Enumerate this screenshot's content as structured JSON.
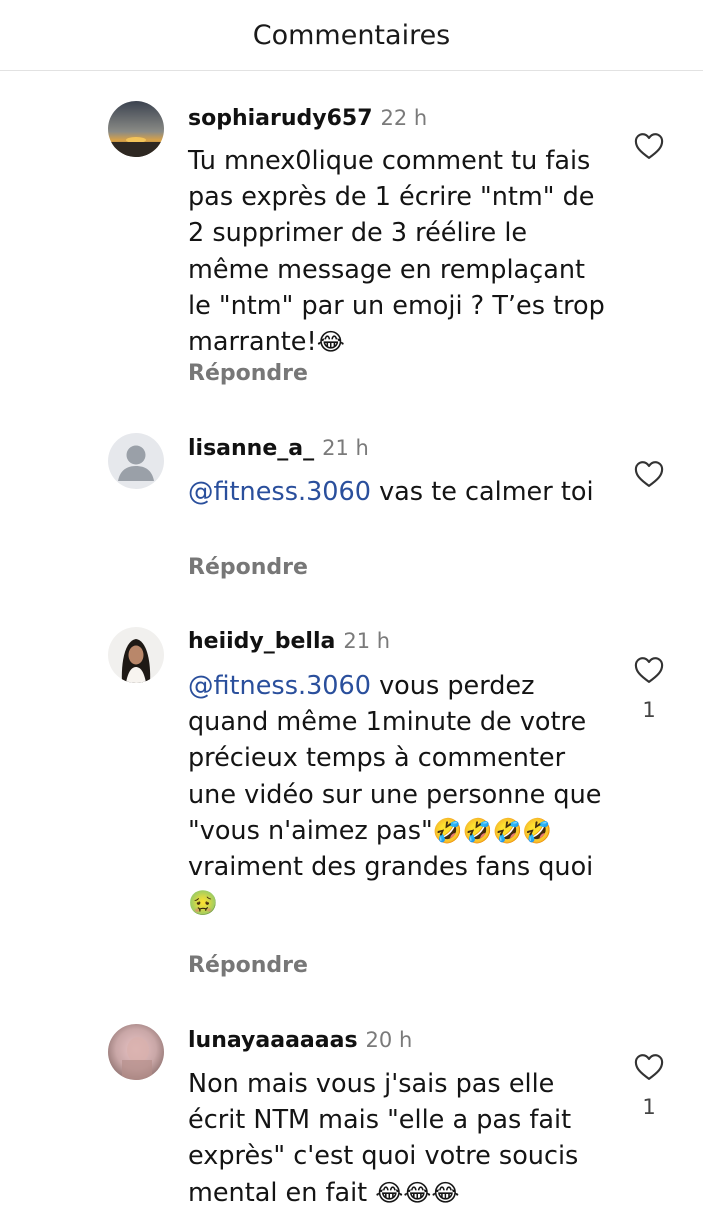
{
  "header": {
    "title": "Commentaires"
  },
  "comments": [
    {
      "username": "sophiarudy657",
      "time": "22 h",
      "text": "Tu mnex0lique comment tu fais pas exprès de 1 écrire \"ntm\" de 2 supprimer de 3 réélire le même message en remplaçant le \"ntm\" par un emoji ? T’es trop marrante!",
      "emoji": "😂",
      "reply": "Répondre",
      "avatar": "sunset-avatar"
    },
    {
      "username": "lisanne_a_",
      "time": "21 h",
      "mention": "@fitness.3060",
      "text": " vas te calmer toi",
      "reply": "Répondre",
      "avatar": "default-user-avatar"
    },
    {
      "username": "heiidy_bella",
      "time": "21 h",
      "mention": "@fitness.3060",
      "text": " vous perdez quand même 1minute de votre précieux temps à commenter une vidéo sur une personne que \"vous n'aimez pas\"",
      "emoji": "🤣🤣🤣🤣",
      "text2": " vraiment des grandes fans quoi",
      "emoji2": "🤢",
      "reply": "Répondre",
      "likes": "1",
      "avatar": "woman-portrait-avatar"
    },
    {
      "username": "lunayaaaaaas",
      "time": "20 h",
      "text": "Non mais vous j'sais pas elle écrit NTM mais \"elle a pas fait exprès\" c'est quoi votre soucis mental en fait ",
      "emoji": "😂😂😂",
      "likes": "1",
      "avatar": "blurred-photo-avatar"
    }
  ],
  "colors": {
    "mention": "#2a4f9c",
    "secondary_text": "#777777"
  },
  "icons": {
    "like": "heart-outline-icon"
  }
}
